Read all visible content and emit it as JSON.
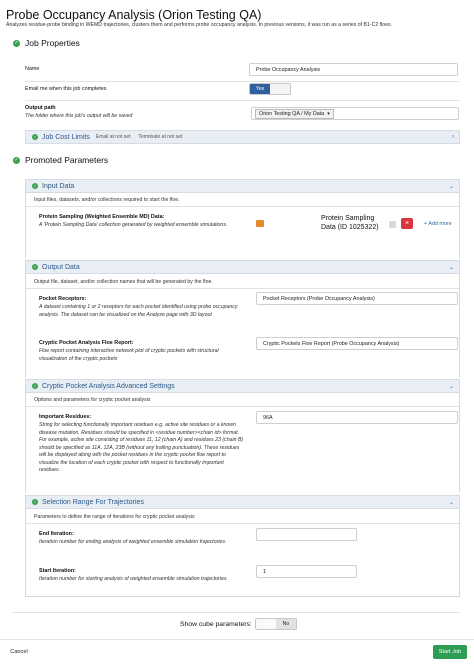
{
  "header": {
    "title": "Probe Occupancy Analysis (Orion Testing QA)",
    "description": "Analyzes residue-probe binding in WEMD trajectories, clusters them and performs probe occupancy analysis. In previous versions, it was run as a series of B1-C2 floes."
  },
  "job_properties": {
    "title": "Job Properties",
    "name_label": "Name",
    "name_value": "Probe Occupancy Analysis",
    "email_label": "Email me when this job completes",
    "email_toggle": "Yes",
    "output_label": "Output path",
    "output_desc": "The folder where this job's output will be saved",
    "output_value": "Orion Testing QA / My Data",
    "cost": {
      "title": "Job Cost Limits",
      "email": "Email at not set",
      "terminate": "Terminate at not set"
    }
  },
  "promoted": {
    "title": "Promoted Parameters"
  },
  "input_data": {
    "title": "Input Data",
    "desc": "Input files, datasets, and/or collections required to start the floe.",
    "field_label": "Protein Sampling (Weighted Ensemble MD) Data:",
    "field_desc": "A 'Protein Sampling Data' collection generated by weighted ensemble simulations.",
    "value": "Protein Sampling Data (ID 1025322)",
    "add_more": "+ Add more"
  },
  "output_data": {
    "title": "Output Data",
    "desc": "Output file, dataset, and/or collection names that will be generated by the floe.",
    "receptors_label": "Pocket Receptors:",
    "receptors_desc": "A dataset containing 1 or 2 receptors for each pocket identified using probe occupancy analysis. The dataset can be visualized on the Analyze page with 3D layout",
    "receptors_value": "Pocket Receptors (Probe Occupancy Analysis)",
    "report_label": "Cryptic Pocket Analysis Floe Report:",
    "report_desc": "Floe report containing interactive network plot of cryptic pockets with structural visualization of the cryptic pockets",
    "report_value": "Cryptic Pockets Floe Report (Probe Occupancy Analysis)"
  },
  "advanced": {
    "title": "Cryptic Pocket Analysis Advanced Settings",
    "desc": "Options and parameters for cryptic pocket analysis",
    "residues_label": "Important Residues:",
    "residues_desc": "String for selecting functionally important residues e.g. active site residues or a known disease mutation. Residues should be specified in <residue number><chain id> format. For example, active site consisting of residues 11, 12 (chain A) and residues 23 (chain B) should be specified as 11A, 12A, 23B (without any trailing punctuation). These residues will be displayed along with the pocket residues in the cryptic pocket floe report to visualize the location of each cryptic pocket with respect to functionally important residues.",
    "residues_value": "96A"
  },
  "selection": {
    "title": "Selection Range For Trajectories",
    "desc": "Parameters to define the range of iterations for cryptic pocket analysis",
    "end_label": "End Iteration:",
    "end_desc": "Iteration number for ending analysis of weighted ensemble simulation trajectories.",
    "end_value": "",
    "start_label": "Start Iteration:",
    "start_desc": "Iteration number for starting analysis of weighted ensemble simulation trajectories.",
    "start_value": "1"
  },
  "footer": {
    "cube_label": "Show cube parameters:",
    "cube_toggle": "No",
    "cancel": "Cancel",
    "start": "Start Job"
  },
  "colors": {
    "accent": "#2f5f9e",
    "success": "#3aa14f",
    "start_button": "#2e9e55",
    "danger": "#d9363e"
  }
}
